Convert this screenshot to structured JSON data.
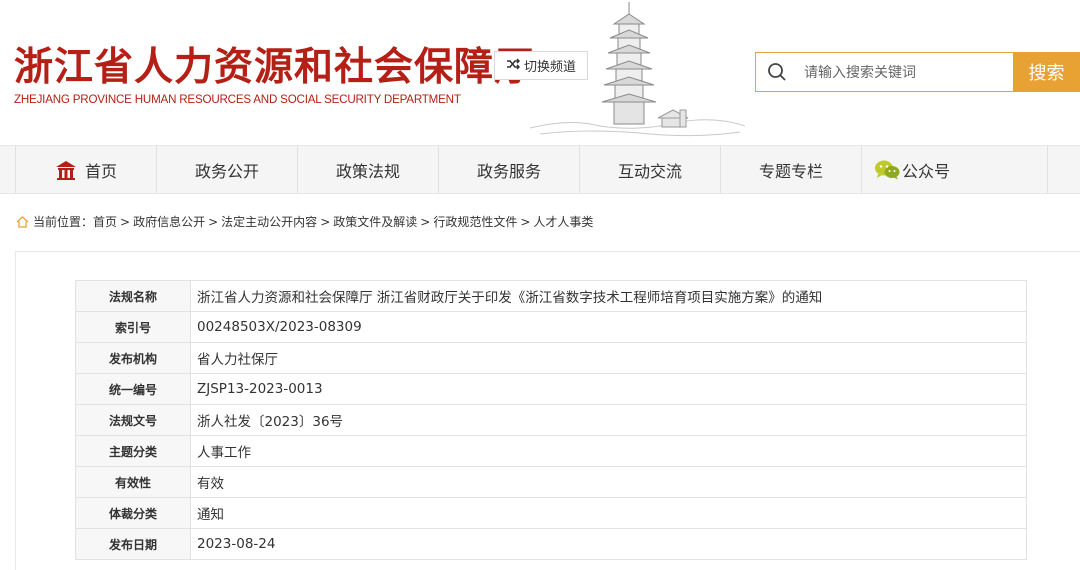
{
  "header": {
    "title_cn": "浙江省人力资源和社会保障厅",
    "title_en": "ZHEJIANG PROVINCE HUMAN RESOURCES AND SOCIAL SECURITY DEPARTMENT",
    "switch_label": "切换频道",
    "search_placeholder": "请输入搜索关键词",
    "search_button": "搜索"
  },
  "nav": {
    "items": [
      {
        "label": "首页",
        "icon": "home-icon"
      },
      {
        "label": "政务公开"
      },
      {
        "label": "政策法规"
      },
      {
        "label": "政务服务"
      },
      {
        "label": "互动交流"
      },
      {
        "label": "专题专栏"
      },
      {
        "label": "公众号",
        "icon": "wechat-icon"
      }
    ]
  },
  "breadcrumb": {
    "prefix": "当前位置：",
    "items": [
      "首页",
      "政府信息公开",
      "法定主动公开内容",
      "政策文件及解读",
      "行政规范性文件",
      "人才人事类"
    ],
    "sep": ">"
  },
  "meta": {
    "rows": [
      {
        "key": "法规名称",
        "value": "浙江省人力资源和社会保障厅 浙江省财政厅关于印发《浙江省数字技术工程师培育项目实施方案》的通知"
      },
      {
        "key": "索引号",
        "value": "00248503X/2023-08309"
      },
      {
        "key": "发布机构",
        "value": "省人力社保厅"
      },
      {
        "key": "统一编号",
        "value": "ZJSP13-2023-0013"
      },
      {
        "key": "法规文号",
        "value": "浙人社发〔2023〕36号"
      },
      {
        "key": "主题分类",
        "value": "人事工作"
      },
      {
        "key": "有效性",
        "value": "有效"
      },
      {
        "key": "体裁分类",
        "value": "通知"
      },
      {
        "key": "发布日期",
        "value": "2023-08-24"
      }
    ]
  },
  "colors": {
    "brand_red": "#b52016",
    "accent_orange": "#e8a234"
  }
}
